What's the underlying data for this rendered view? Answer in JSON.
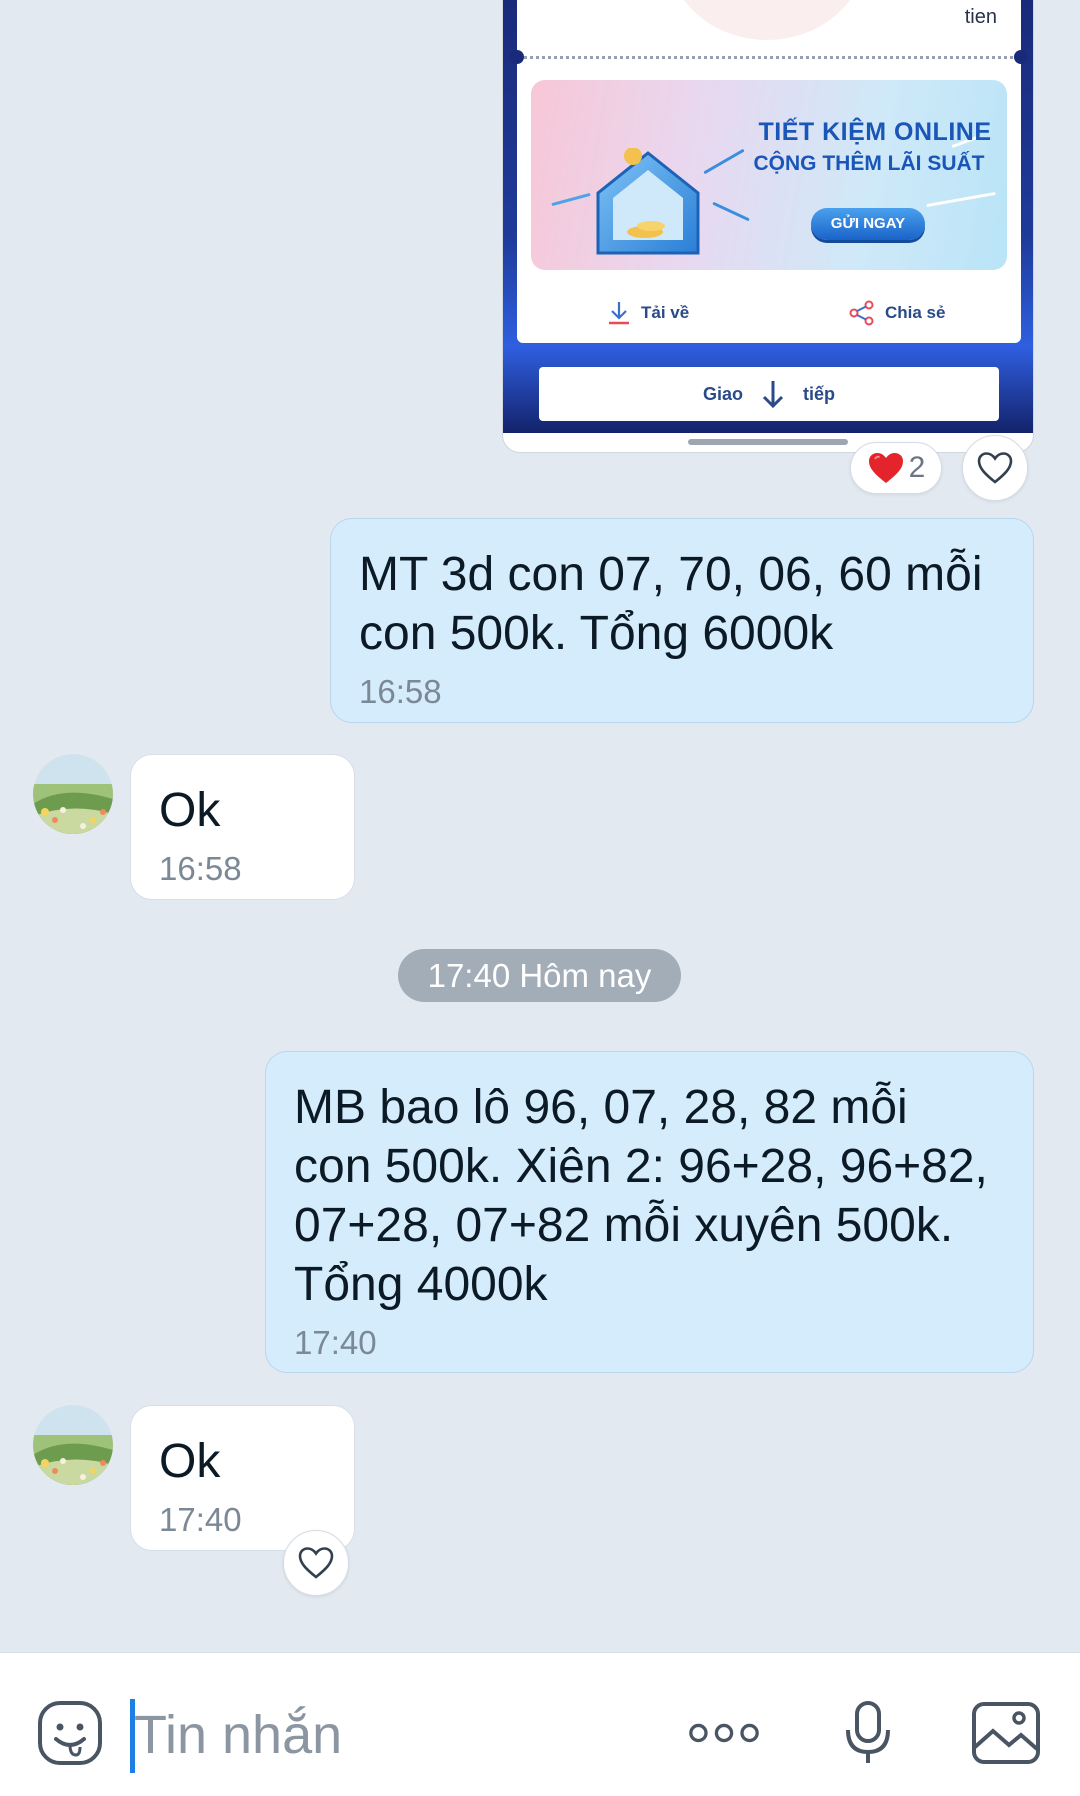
{
  "image_message": {
    "receipt_top_text": "tien",
    "promo_title": "TIẾT KIỆM ONLINE",
    "promo_subtitle": "CỘNG THÊM LÃI SUẤT",
    "promo_button": "GỬI NGAY",
    "download_label": "Tải về",
    "share_label": "Chia sẻ",
    "continue_label_left": "Giao",
    "continue_label_right": "tiếp",
    "reaction_count": "2"
  },
  "messages": [
    {
      "direction": "sent",
      "text": "MT 3d con 07, 70, 06, 60 mỗi\ncon 500k. Tổng 6000k",
      "time": "16:58"
    },
    {
      "direction": "received",
      "text": "Ok",
      "time": "16:58"
    },
    {
      "direction": "sent",
      "text": "MB bao lô 96, 07, 28, 82 mỗi\ncon 500k. Xiên 2: 96+28, 96+82,\n07+28, 07+82 mỗi xuyên 500k.\nTổng 4000k",
      "time": "17:40"
    },
    {
      "direction": "received",
      "text": "Ok",
      "time": "17:40"
    }
  ],
  "date_divider": "17:40 Hôm nay",
  "composer": {
    "placeholder": "Tin nhắn"
  },
  "icons": {
    "emoji": "emoji-icon",
    "more": "more-options-icon",
    "mic": "microphone-icon",
    "image": "image-icon",
    "heart": "heart-icon"
  },
  "colors": {
    "background": "#e2e9f1",
    "sent_bubble": "#d5ecfc",
    "received_bubble": "#ffffff",
    "date_chip": "#a3adb8",
    "caret": "#1d7fe6"
  }
}
